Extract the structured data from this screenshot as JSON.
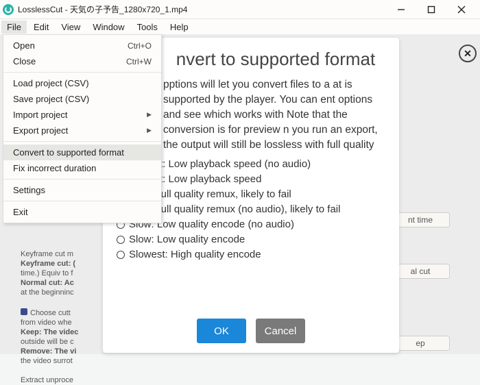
{
  "titlebar": {
    "text": "LosslessCut - 天気の子予告_1280x720_1.mp4"
  },
  "menubar": [
    "File",
    "Edit",
    "View",
    "Window",
    "Tools",
    "Help"
  ],
  "file_menu": {
    "open": "Open",
    "open_key": "Ctrl+O",
    "close": "Close",
    "close_key": "Ctrl+W",
    "load_csv": "Load project (CSV)",
    "save_csv": "Save project (CSV)",
    "import": "Import project",
    "export": "Export project",
    "convert": "Convert to supported format",
    "fix": "Fix incorrect duration",
    "settings": "Settings",
    "exit": "Exit"
  },
  "background": {
    "side1_a": "Keyframe cut m",
    "side1_b": "Keyframe cut: (",
    "side1_c": "time.) Equiv to f",
    "side1_d": "Normal cut: Ac",
    "side1_e": "at the beginninc",
    "side2_a": "Choose cutt",
    "side2_b": "from video whe",
    "side2_c": "Keep: The videc",
    "side2_d": "outside will be c",
    "side2_e": "Remove: The vi",
    "side2_f": "the video surrot",
    "side2_g": "Extract unproce",
    "btn1": "nt time",
    "btn2": "al cut",
    "btn3": "ep"
  },
  "dialog": {
    "title": "nvert to supported format",
    "body": "pptions will let you convert files to a at is supported by the player. You can ent options and see which works with Note that the conversion is for preview n you run an export, the output will still be lossless with full quality",
    "opts": [
      "Fastest: Low playback speed (no audio)",
      "Fastest: Low playback speed",
      "Fast: Full quality remux, likely to fail",
      "Fast: Full quality remux (no audio), likely to fail",
      "Slow: Low quality encode (no audio)",
      "Slow: Low quality encode",
      "Slowest: High quality encode"
    ],
    "ok": "OK",
    "cancel": "Cancel"
  }
}
